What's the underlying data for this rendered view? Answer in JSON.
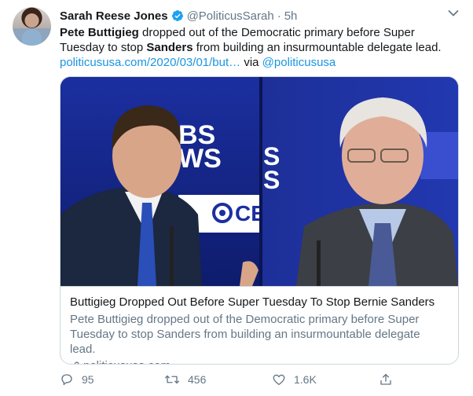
{
  "tweet": {
    "author_name": "Sarah Reese Jones",
    "handle": "@PoliticusSarah",
    "separator": "·",
    "time": "5h",
    "text": {
      "p1_bold": "Pete Buttigieg",
      "p1_rest": " dropped out of the Democratic primary before Super Tuesday to stop ",
      "p2_bold": "Sanders",
      "p2_rest": " from building an insurmountable delegate lead.",
      "link": "politicususa.com/2020/03/01/but…",
      "via": " via ",
      "via_handle": "@politicususa"
    },
    "card": {
      "title": "Buttigieg Dropped Out Before Super Tuesday To Stop Bernie Sanders",
      "description": "Pete Buttigieg dropped out of the Democratic primary before Super Tuesday to stop Sanders from building an insurmountable delegate lead.",
      "domain": "politicususa.com",
      "media": {
        "left_panel_text": "BS\nWS",
        "right_panel_text": "S\nS",
        "logo_text": "CE"
      }
    },
    "actions": {
      "replies": "95",
      "retweets": "456",
      "likes": "1.6K"
    }
  },
  "colors": {
    "link": "#1b95e0",
    "secondary": "#657786",
    "verified": "#1da1f2",
    "border": "#ccd6dd"
  }
}
